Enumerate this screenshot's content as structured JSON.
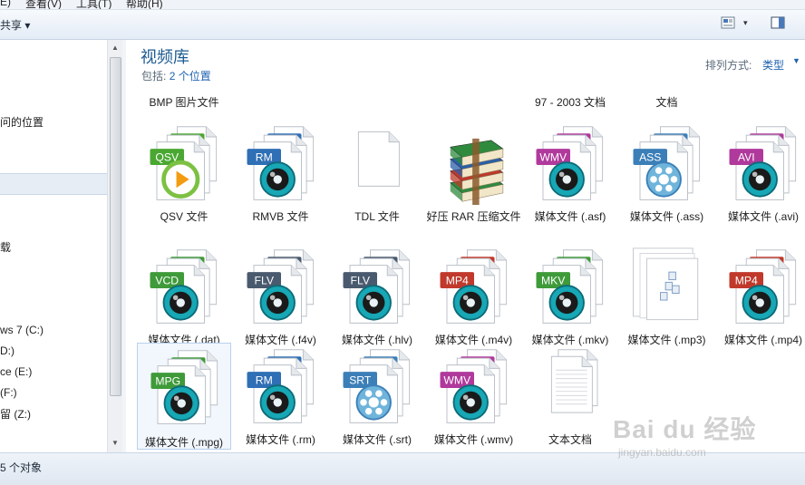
{
  "menu": {
    "items": [
      "E)",
      "查看(V)",
      "工具(T)",
      "帮助(H)"
    ]
  },
  "toolbar": {
    "share_label": "共享 ▾",
    "view_caret": "▾"
  },
  "sidebar": {
    "items": [
      "问的位置",
      "载",
      "ws 7 (C:)",
      "D:)",
      "ce  (E:)",
      "(F:)",
      "留 (Z:)"
    ]
  },
  "library": {
    "title": "视频库",
    "includes_label": "包括:",
    "includes_link": "2 个位置",
    "sort_label": "排列方式:",
    "sort_value": "类型"
  },
  "prev_row": [
    {
      "lines": [
        "BMP 图片文件"
      ]
    },
    {
      "lines": []
    },
    {
      "lines": []
    },
    {
      "lines": []
    },
    {
      "lines": [
        "97 - 2003 文档"
      ]
    },
    {
      "lines": [
        "文档"
      ]
    },
    {
      "lines": []
    }
  ],
  "files": [
    {
      "label": "QSV 文件",
      "badge": "QSV",
      "color": "#4aa832",
      "kind": "qsv"
    },
    {
      "label": "RMVB 文件",
      "badge": "RM",
      "color": "#2f6fb5",
      "kind": "media"
    },
    {
      "label": "TDL 文件",
      "badge": "",
      "color": "#cccccc",
      "kind": "blank"
    },
    {
      "label": "好压 RAR 压缩文件",
      "badge": "",
      "color": "#3b7f3b",
      "kind": "rar"
    },
    {
      "label": "媒体文件 (.asf)",
      "badge": "WMV",
      "color": "#b0399c",
      "kind": "media"
    },
    {
      "label": "媒体文件 (.ass)",
      "badge": "ASS",
      "color": "#3c7fb8",
      "kind": "sub"
    },
    {
      "label": "媒体文件 (.avi)",
      "badge": "AVI",
      "color": "#b0399c",
      "kind": "media"
    },
    {
      "label": "媒体文件 (.dat)",
      "badge": "VCD",
      "color": "#3f9a3a",
      "kind": "media"
    },
    {
      "label": "媒体文件 (.f4v)",
      "badge": "FLV",
      "color": "#4a5a6e",
      "kind": "media"
    },
    {
      "label": "媒体文件 (.hlv)",
      "badge": "FLV",
      "color": "#4a5a6e",
      "kind": "media"
    },
    {
      "label": "媒体文件 (.m4v)",
      "badge": "MP4",
      "color": "#c0392b",
      "kind": "media"
    },
    {
      "label": "媒体文件 (.mkv)",
      "badge": "MKV",
      "color": "#3f9a3a",
      "kind": "media"
    },
    {
      "label": "媒体文件 (.mp3)",
      "badge": "",
      "color": "#cccccc",
      "kind": "mp3"
    },
    {
      "label": "媒体文件 (.mp4)",
      "badge": "MP4",
      "color": "#c0392b",
      "kind": "media"
    },
    {
      "label": "媒体文件 (.mpg)",
      "badge": "MPG",
      "color": "#3f9a3a",
      "kind": "media",
      "selected": true
    },
    {
      "label": "媒体文件 (.rm)",
      "badge": "RM",
      "color": "#2f6fb5",
      "kind": "media"
    },
    {
      "label": "媒体文件 (.srt)",
      "badge": "SRT",
      "color": "#3c7fb8",
      "kind": "sub"
    },
    {
      "label": "媒体文件 (.wmv)",
      "badge": "WMV",
      "color": "#b0399c",
      "kind": "media"
    },
    {
      "label": "文本文档",
      "badge": "",
      "color": "#cccccc",
      "kind": "text"
    }
  ],
  "status": {
    "count_label": "5 个对象"
  },
  "watermark": {
    "main": "Bai du 经验",
    "sub": "jingyan.baidu.com"
  }
}
